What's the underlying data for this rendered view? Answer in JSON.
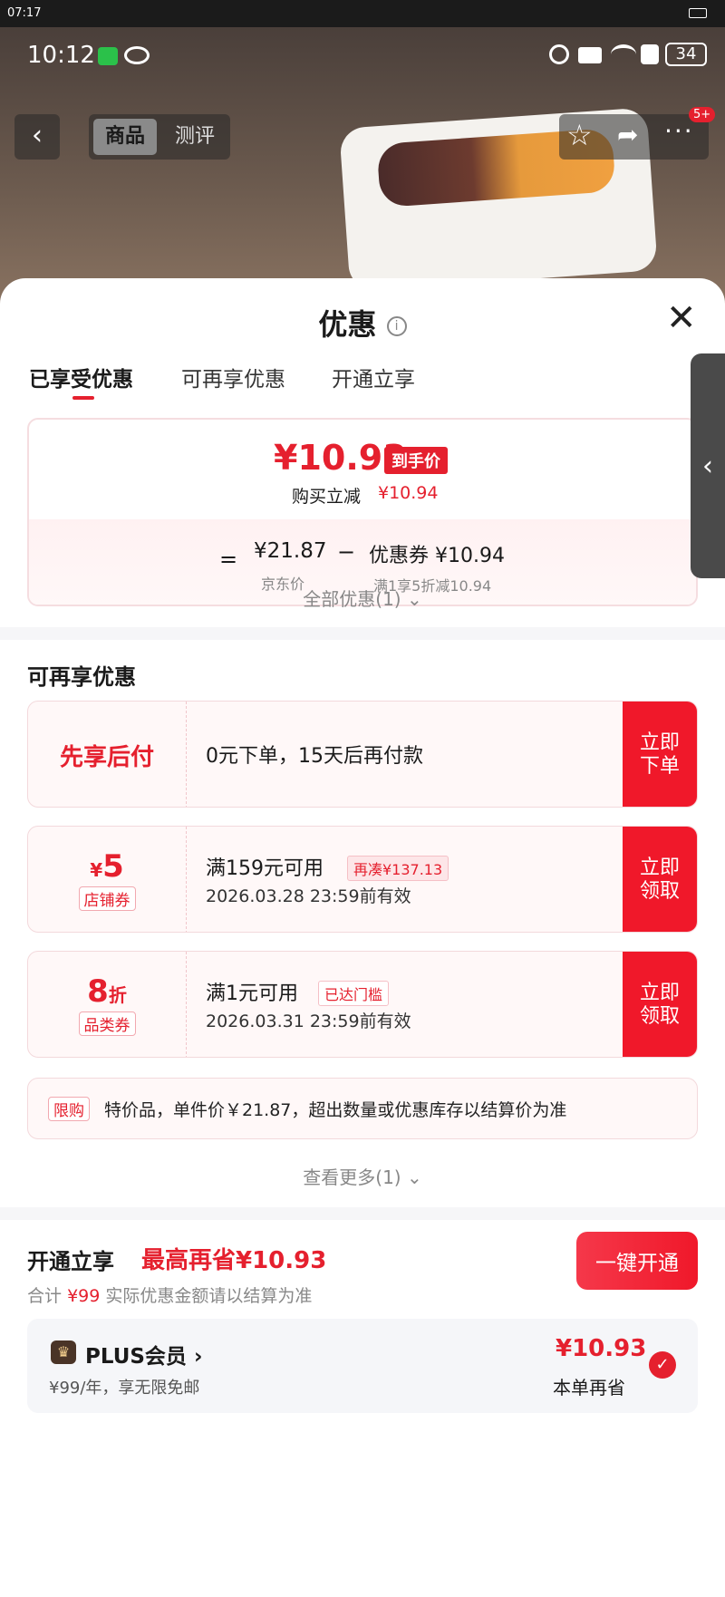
{
  "system_bar": {
    "time": "07:17"
  },
  "status_bar": {
    "time": "10:12",
    "battery": "34"
  },
  "nav": {
    "tab_product": "商品",
    "tab_review": "测评",
    "badge": "5+"
  },
  "sheet": {
    "title": "优惠",
    "tabs": [
      "已享受优惠",
      "可再享优惠",
      "开通立享"
    ],
    "summary": {
      "price": "¥10.93",
      "price_tag": "到手价",
      "discount_label": "购买立减",
      "discount_value": "¥10.94",
      "eq": "=",
      "jd_price": "¥21.87",
      "jd_label": "京东价",
      "minus": "−",
      "coupon_label": "优惠券 ¥10.94",
      "coupon_desc": "满1享5折减10.94"
    },
    "all_discounts": "全部优惠(1)",
    "more_section_title": "可再享优惠",
    "coupons": [
      {
        "left_main": "先享后付",
        "text": "0元下单，15天后再付款",
        "button": "立即\n下单"
      },
      {
        "left_main_symbol": "¥",
        "left_main": "5",
        "left_tag": "店铺券",
        "text": "满159元可用",
        "badge": "再凑¥137.13",
        "date": "2026.03.28 23:59前有效",
        "button": "立即\n领取"
      },
      {
        "left_main": "8",
        "left_main_suffix": "折",
        "left_tag": "品类券",
        "text": "满1元可用",
        "badge": "已达门槛",
        "date": "2026.03.31 23:59前有效",
        "button": "立即\n领取"
      }
    ],
    "limit": {
      "tag": "限购",
      "text": "特价品，单件价￥21.87，超出数量或优惠库存以结算价为准"
    },
    "see_more": "查看更多(1)",
    "open": {
      "title": "开通立享",
      "max_save": "最高再省¥10.93",
      "total_prefix": "合计",
      "total_value": "¥99",
      "total_suffix": "实际优惠金额请以结算为准",
      "button": "一键开通",
      "plus_name": "PLUS会员",
      "plus_desc": "¥99/年，享无限免邮",
      "plus_save": "¥10.93",
      "plus_save_label": "本单再省"
    }
  },
  "colors": {
    "accent": "#e5202e",
    "button": "#f0182a"
  }
}
